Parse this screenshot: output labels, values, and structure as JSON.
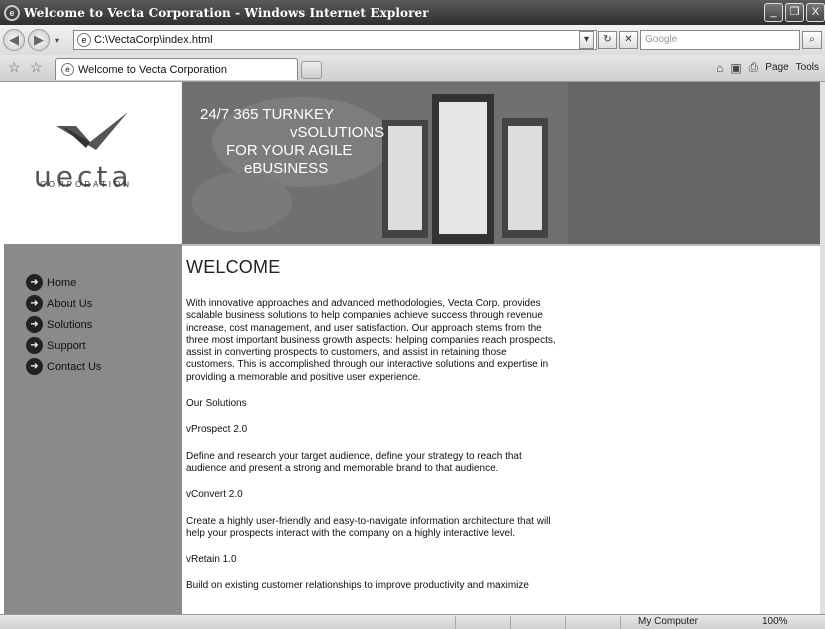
{
  "window": {
    "title": "Welcome to Vecta Corporation - Windows Internet Explorer",
    "minimize": "_",
    "restore": "❐",
    "close": "X"
  },
  "addressbar": {
    "back_icon": "◀",
    "forward_icon": "▶",
    "url": "C:\\VectaCorp\\index.html",
    "dropdown": "▾",
    "refresh": "↻",
    "stop": "✕",
    "search_placeholder": "Google",
    "search_icon": "⌕"
  },
  "tabs": {
    "favorites_icon": "☆",
    "add_favorites_icon": "☆",
    "active_tab": "Welcome to Vecta Corporation",
    "commands": {
      "home": "⌂",
      "feeds": "▣",
      "print": "⎙",
      "page": "Page",
      "tools": "Tools"
    }
  },
  "page": {
    "logo": {
      "word": "uecta",
      "sub": "CORPORATION"
    },
    "banner": {
      "line1": "24/7 365 TURNKEY",
      "line2": "vSOLUTIONS",
      "line3": "FOR YOUR AGILE",
      "line4": "eBUSINESS"
    },
    "nav": [
      {
        "label": "Home"
      },
      {
        "label": "About Us"
      },
      {
        "label": "Solutions"
      },
      {
        "label": "Support"
      },
      {
        "label": "Contact Us"
      }
    ],
    "heading": "WELCOME",
    "paragraphs": [
      "With innovative approaches and advanced methodologies, Vecta Corp. provides scalable business solutions to help companies achieve success through revenue increase, cost management, and user satisfaction. Our approach stems from the three most important business growth aspects: helping companies reach prospects, assist in converting prospects to customers, and assist in retaining those customers. This is accomplished through our interactive solutions and expertise in providing a memorable and positive user experience.",
      "Our Solutions",
      "vProspect 2.0",
      "Define and research your target audience, define your strategy to reach that audience and present a strong and memorable brand to that audience.",
      "vConvert 2.0",
      "Create a highly user-friendly and easy-to-navigate information architecture that will help your prospects interact with the company on a highly interactive level.",
      "vRetain 1.0",
      "Build on existing customer relationships to improve productivity and maximize"
    ]
  },
  "status": {
    "zone": "My Computer",
    "zoom": "100%"
  }
}
